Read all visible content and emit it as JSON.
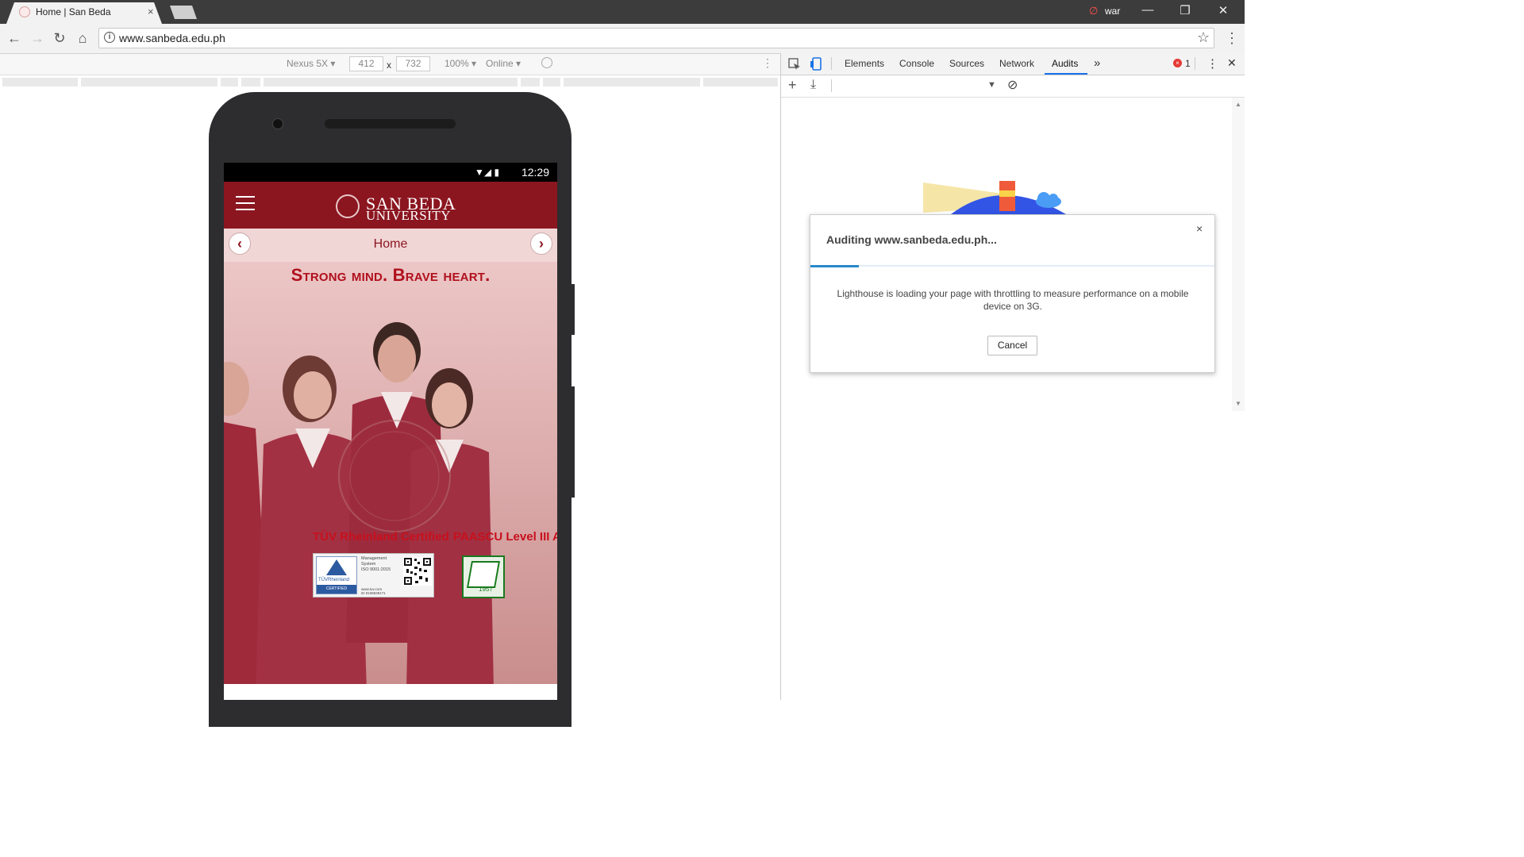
{
  "browser": {
    "tab_title": "Home | San Beda",
    "tab_close": "×",
    "profile_name": "war",
    "profile_icon": "∅",
    "url": "www.sanbeda.edu.ph",
    "window_controls": {
      "minimize": "—",
      "restore": "❐",
      "close": "✕"
    },
    "nav": {
      "back": "←",
      "forward": "→",
      "reload": "↻",
      "home": "⌂"
    },
    "star": "☆",
    "menu": "⋮"
  },
  "device_toolbar": {
    "device": "Nexus 5X ▾",
    "width": "412",
    "height": "732",
    "times": "x",
    "zoom": "100% ▾",
    "network": "Online ▾",
    "rotate_icon": "⃠",
    "more": "⋮"
  },
  "phone": {
    "status_time": "12:29",
    "status_icons": "▼◢ ▮",
    "site": {
      "brand_line1": "SAN BEDA",
      "brand_line2": "UNIVERSITY",
      "nav_title": "Home",
      "prev": "‹",
      "next": "›",
      "tagline": "Strong mind. Brave heart.",
      "cert1": "TÜV Rheinland Certified",
      "cert2": "PAASCU Level III Acc",
      "tuv_badge": {
        "brand": "TÜVRheinland",
        "certified": "CERTIFIED",
        "system_line1": "Management",
        "system_line2": "System",
        "system_line3": "ISO 9001:2015",
        "site": "www.tuv.com",
        "id": "ID 9108639171"
      },
      "paascu_year": "1957"
    }
  },
  "devtools": {
    "tabs": [
      "Elements",
      "Console",
      "Sources",
      "Network",
      "Audits"
    ],
    "active_tab": "Audits",
    "overflow": "»",
    "error_count": "1",
    "more": "⋮",
    "close": "✕",
    "toolbar": {
      "add": "+",
      "download": "⤓",
      "dropdown": "▼",
      "clear": "⊘"
    },
    "dialog": {
      "title": "Auditing www.sanbeda.edu.ph...",
      "close": "×",
      "progress": 0.12,
      "message": "Lighthouse is loading your page with throttling to measure performance on a mobile device on 3G.",
      "cancel": "Cancel"
    }
  },
  "colors": {
    "brand_red": "#8b1620",
    "accent_blue": "#1a73e8",
    "progress_blue": "#2a89c9"
  },
  "icons": [
    "info-icon",
    "star-icon",
    "menu-icon",
    "hamburger-icon",
    "inspect-icon",
    "device-toggle-icon",
    "error-icon",
    "close-icon"
  ]
}
